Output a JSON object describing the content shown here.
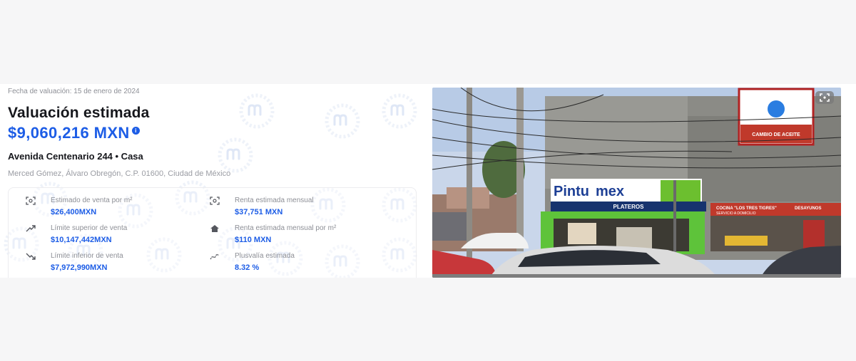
{
  "valuation": {
    "date_label": "Fecha de valuación:",
    "date_value": "15 de enero de 2024",
    "title": "Valuación estimada",
    "price": "$9,060,216 MXN",
    "info_glyph": "i",
    "address": "Avenida Centenario 244 • Casa",
    "location": "Merced Gómez, Álvaro Obregón, C.P. 01600, Ciudad de México"
  },
  "stats": [
    {
      "icon": "sale-price-per-m2-icon",
      "label": "Estimado de venta por m²",
      "value": "$26,400MXN"
    },
    {
      "icon": "monthly-rent-icon",
      "label": "Renta estimada mensual",
      "value": "$37,751 MXN"
    },
    {
      "icon": "trend-up-icon",
      "label": "Límite superior de venta",
      "value": "$10,147,442MXN"
    },
    {
      "icon": "home-icon",
      "label": "Renta estimada mensual por m²",
      "value": "$110 MXN"
    },
    {
      "icon": "trend-down-icon",
      "label": "Límite inferior de venta",
      "value": "$7,972,990MXN"
    },
    {
      "icon": "appreciation-icon",
      "label": "Plusvalía estimada",
      "value": "8.32 %"
    }
  ],
  "photo": {
    "store_name_a": "Pintu",
    "store_name_b": "mex",
    "store_sub": "PLATEROS",
    "sign_right": "CAMBIO DE ACEITE",
    "restaurant": "COCINA \"LOS TRES TIGRES\"",
    "restaurant_sub": "SERVICIO A DOMICILIO",
    "desayunos": "DESAYUNOS"
  },
  "colors": {
    "accent": "#1d5de6",
    "text": "#16171c",
    "muted": "#8d8f96"
  }
}
